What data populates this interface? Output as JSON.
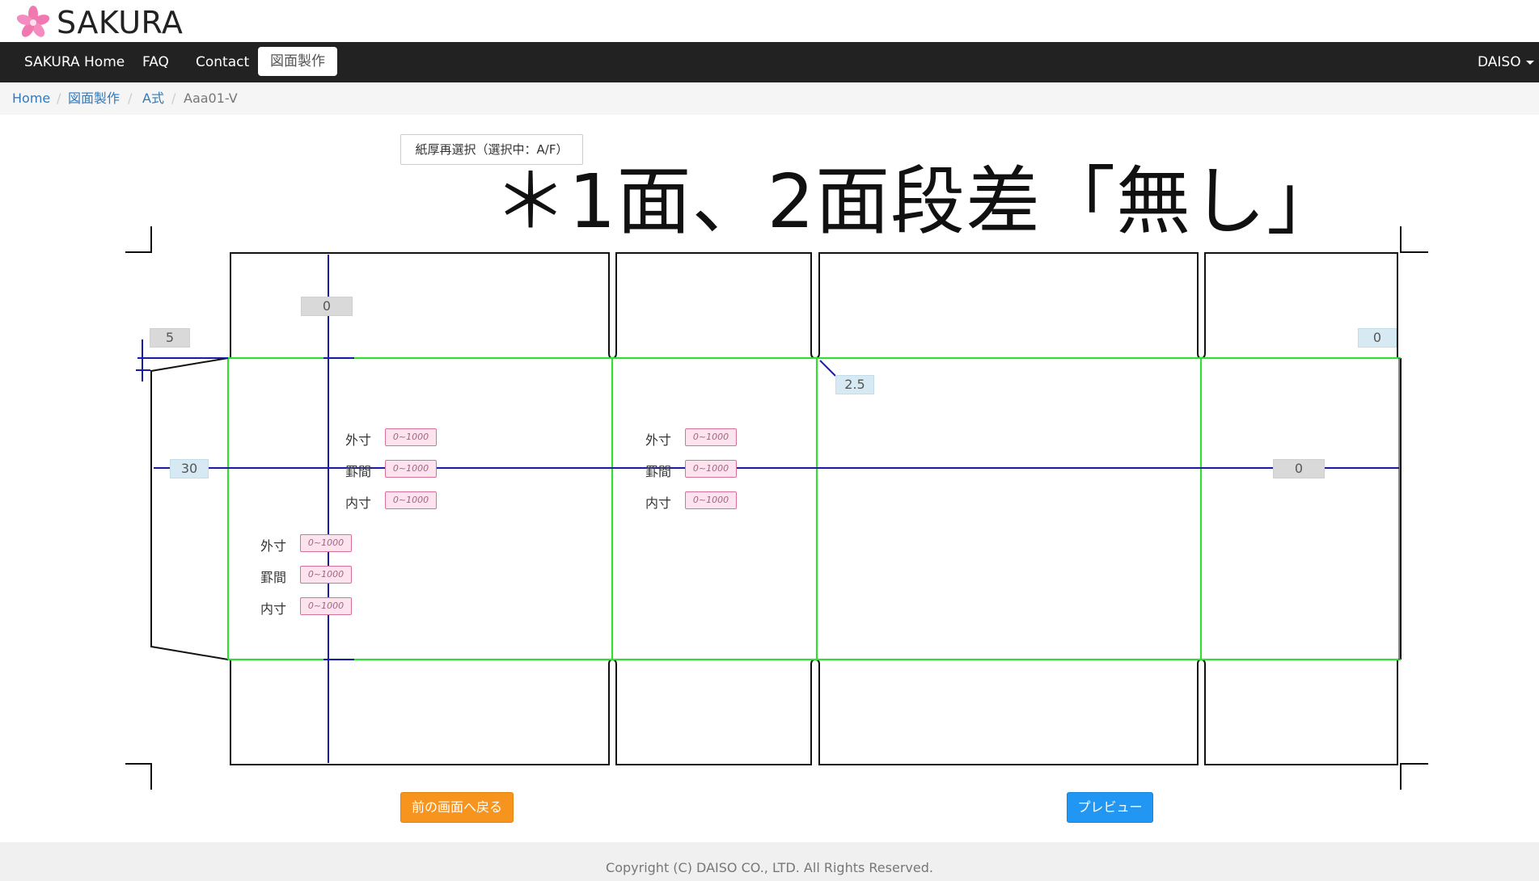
{
  "brand": {
    "name": "SAKURA"
  },
  "nav": {
    "items": [
      "SAKURA Home",
      "FAQ",
      "Contact",
      "図面製作"
    ],
    "user": "DAISO"
  },
  "breadcrumb": [
    "Home",
    "図面製作",
    "A式",
    "Aaa01-V"
  ],
  "paper_button": "紙厚再選択（選択中：A/F）",
  "note": "＊1面、2面段差「無し」",
  "dimensions": {
    "top_flap": "0",
    "glue_top": "5",
    "right_top": "0",
    "diag": "2.5",
    "glue_width": "30",
    "right_mid": "0"
  },
  "input_labels": {
    "outer": "外寸",
    "crease": "罫間",
    "inner": "内寸"
  },
  "input_placeholder": "0~1000",
  "buttons": {
    "back": "前の画面へ戻る",
    "preview": "プレビュー"
  },
  "footer": "Copyright (C) DAISO CO., LTD. All Rights Reserved.",
  "colors": {
    "accent_orange": "#f7941d",
    "accent_blue": "#2196f3",
    "fold_green": "#33dd33",
    "dim_blue": "#1a1aa8"
  }
}
